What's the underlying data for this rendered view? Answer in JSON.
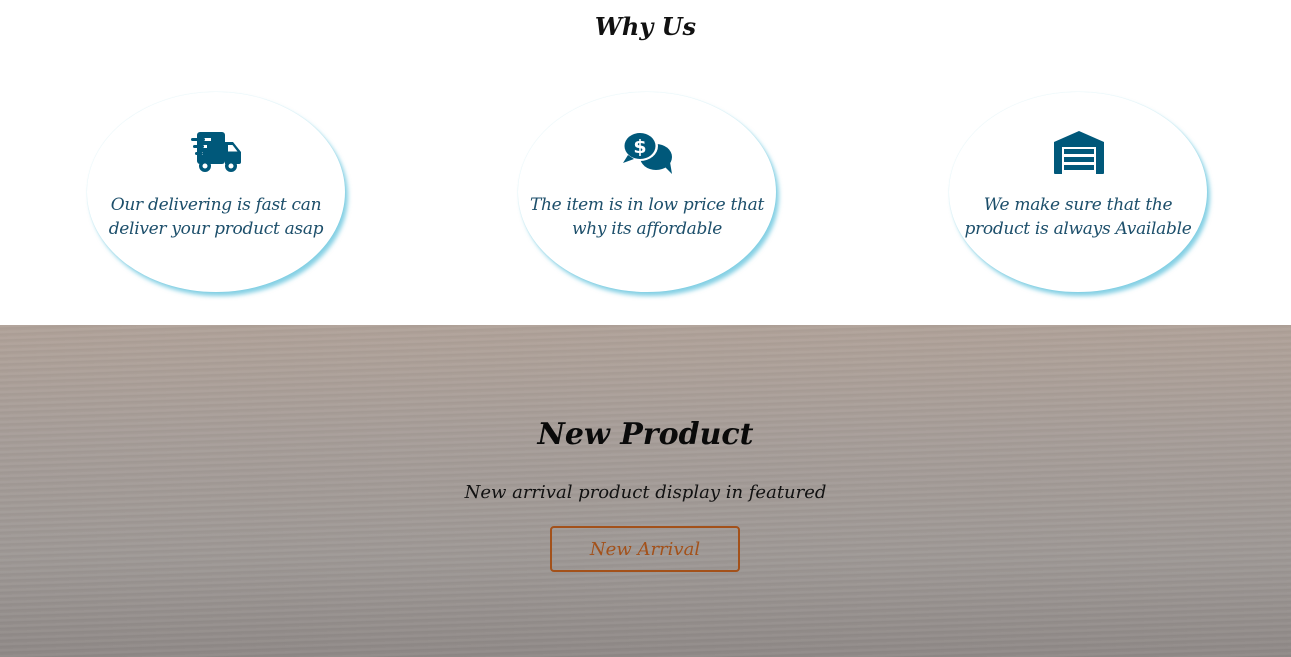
{
  "why_us": {
    "title": "Why Us",
    "features": [
      {
        "icon": "shipping-fast-icon",
        "text": "Our delivering is fast can deliver your product asap"
      },
      {
        "icon": "price-chat-icon",
        "text": "The item is in low price that why its affordable"
      },
      {
        "icon": "warehouse-icon",
        "text": "We make sure that the product is always Available"
      }
    ]
  },
  "new_product": {
    "title": "New Product",
    "subtitle": "New arrival product display in featured",
    "button_label": "New Arrival"
  },
  "colors": {
    "icon": "#00587a",
    "feature_text": "#1d4f6b",
    "card_shadow": "#20aacd",
    "button": "#a3511a"
  }
}
